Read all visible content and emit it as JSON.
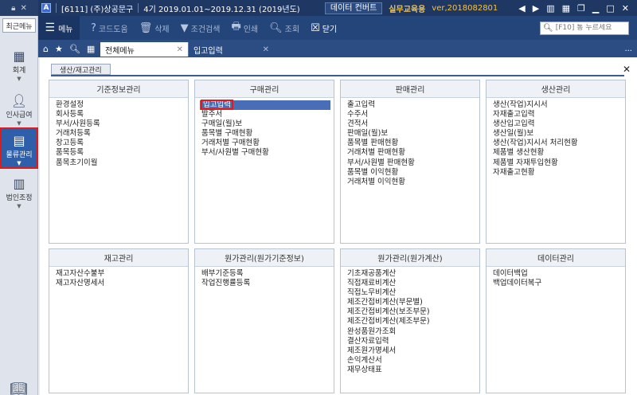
{
  "titlebar": {
    "lock_icon": "lock-icon",
    "close_x": "✕",
    "app_letter": "A",
    "company": "[6111] (주)상공문구",
    "period": "4기 2019.01.01~2019.12.31 (2019년도)",
    "convert_label": "데이터 컨버트",
    "brand": "실무교육용",
    "version": "ver,2018082801"
  },
  "sidebar": {
    "recent_label": "최근메뉴",
    "items": [
      {
        "label": "회계",
        "icon": "calculator-icon"
      },
      {
        "label": "인사급여",
        "icon": "person-icon"
      },
      {
        "label": "물류관리",
        "icon": "boxes-icon",
        "active": true
      },
      {
        "label": "법인조정",
        "icon": "building-icon"
      }
    ]
  },
  "toolbar": {
    "menu_label": "메뉴",
    "code_help": "코드도움",
    "delete": "삭제",
    "condition_search": "조건검색",
    "print": "인쇄",
    "inquiry": "조회",
    "close": "닫기",
    "search_placeholder": "[F10] 통 누르세요"
  },
  "tabs": {
    "tab1": "전체메뉴",
    "tab2": "입고입력",
    "more": "..."
  },
  "content": {
    "subtab": "생산/재고관리"
  },
  "panels": [
    {
      "title": "기준정보관리",
      "items": [
        "환경설정",
        "회사등록",
        "부서/사원등록",
        "거래처등록",
        "창고등록",
        "품목등록",
        "품목초기이월"
      ]
    },
    {
      "title": "구매관리",
      "items": [
        "입고입력",
        "발주서",
        "구매일(월)보",
        "품목별 구매현황",
        "거래처별 구매현황",
        "부서/사원별 구매현황"
      ],
      "selected": 0
    },
    {
      "title": "판매관리",
      "items": [
        "출고입력",
        "수주서",
        "견적서",
        "판매일(월)보",
        "품목별 판매현황",
        "거래처별 판매현황",
        "부서/사원별 판매현황",
        "품목별 이익현황",
        "거래처별 이익현황"
      ]
    },
    {
      "title": "생산관리",
      "items": [
        "생산(작업)지시서",
        "자재출고입력",
        "생산입고입력",
        "생산일(월)보",
        "생산(작업)지시서 처리현황",
        "제품별 생산현황",
        "제품별 자재투입현황",
        "자재출고현황"
      ]
    },
    {
      "title": "재고관리",
      "items": [
        "재고자산수불부",
        "재고자산명세서"
      ]
    },
    {
      "title": "원가관리(원가기준정보)",
      "items": [
        "배부기준등록",
        "작업진행률등록"
      ]
    },
    {
      "title": "원가관리(원가계산)",
      "items": [
        "기초재공품계산",
        "직접재료비계산",
        "직접노무비계산",
        "제조간접비계산(부문별)",
        "제조간접비계산(보조부문)",
        "제조간접비계산(제조부문)",
        "완성품원가조회",
        "결산자료입력",
        "제조원가명세서",
        "손익계산서",
        "재무상태표"
      ]
    },
    {
      "title": "데이터관리",
      "items": [
        "데이터백업",
        "백업데이터복구"
      ]
    }
  ]
}
